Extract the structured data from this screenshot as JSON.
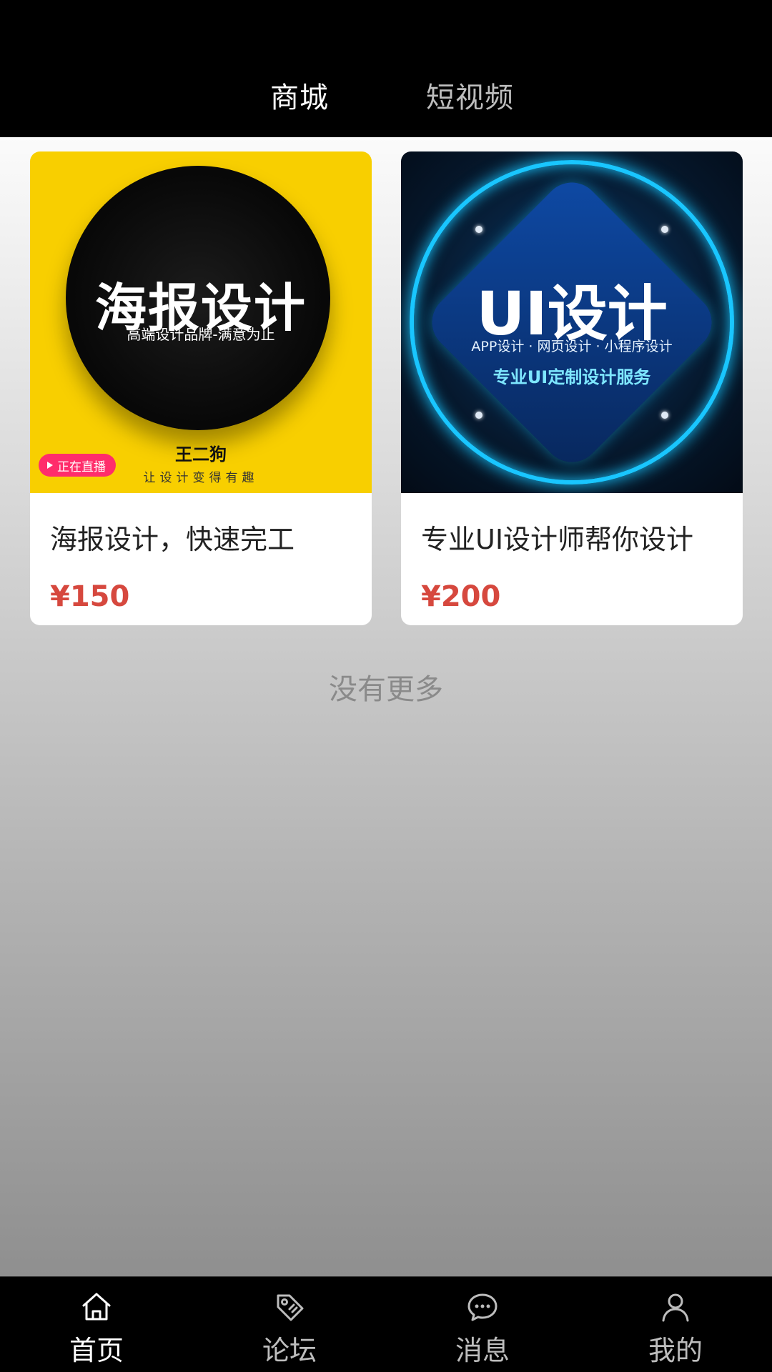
{
  "top_tabs": [
    {
      "label": "商城",
      "active": true
    },
    {
      "label": "短视频",
      "active": false
    }
  ],
  "products": [
    {
      "image_text": {
        "headline": "海报设计",
        "subline": "高端设计品牌-满意为止",
        "brand": "王二狗",
        "slogan": "让设计变得有趣",
        "badge": "正在直播"
      },
      "title": "海报设计，快速完工",
      "price": "¥150"
    },
    {
      "image_text": {
        "headline": "UI设计",
        "subline": "APP设计 · 网页设计 · 小程序设计",
        "subline2": "专业UI定制设计服务"
      },
      "title": "专业UI设计师帮你设计",
      "price": "¥200"
    }
  ],
  "list_end_text": "没有更多",
  "bottom_nav": [
    {
      "label": "首页",
      "icon": "home-icon",
      "active": true
    },
    {
      "label": "论坛",
      "icon": "tag-icon",
      "active": false
    },
    {
      "label": "消息",
      "icon": "chat-bubble-icon",
      "active": false
    },
    {
      "label": "我的",
      "icon": "user-icon",
      "active": false
    }
  ],
  "colors": {
    "price": "#d6483e",
    "poster_background": "#f8cf00",
    "badge": "#ff2d6b",
    "neon": "#19c6ff"
  }
}
